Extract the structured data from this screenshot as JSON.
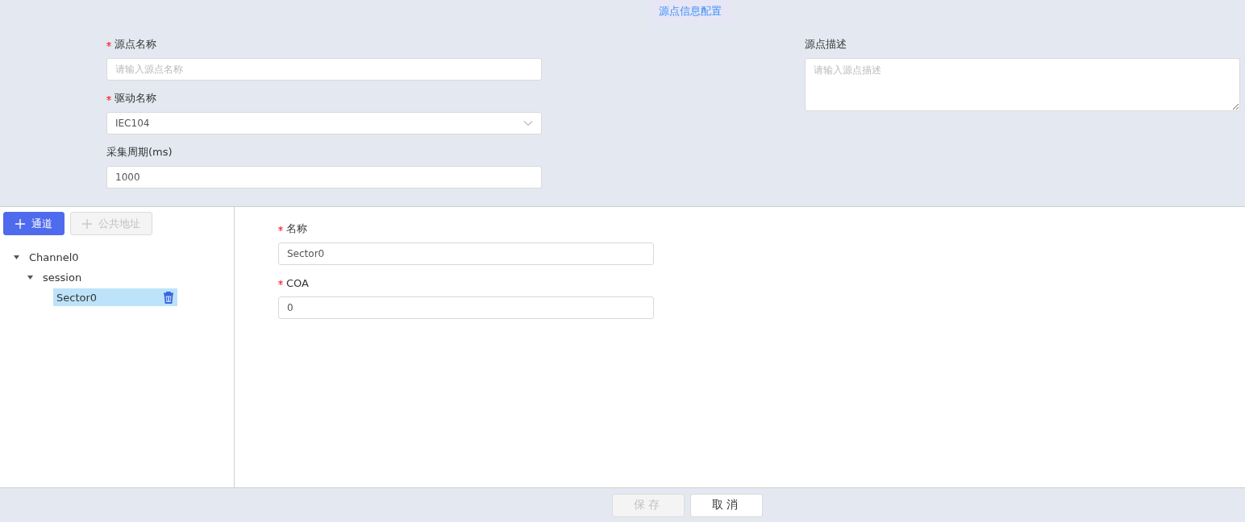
{
  "header": {
    "title": "源点信息配置"
  },
  "source_form": {
    "fields": [
      {
        "label": "源点名称",
        "required": true,
        "kind": "input",
        "placeholder": "请输入源点名称"
      },
      {
        "label": "驱动名称",
        "required": true,
        "kind": "select",
        "value": "IEC104"
      },
      {
        "label": "采集周期(ms)",
        "required": false,
        "kind": "input",
        "value": "1000"
      }
    ],
    "description": {
      "label": "源点描述",
      "required": false,
      "kind": "textarea",
      "placeholder": "请输入源点描述"
    }
  },
  "tree_toolbar": [
    {
      "label": "通道",
      "disabled": false
    },
    {
      "label": "公共地址",
      "disabled": true
    }
  ],
  "tree": [
    {
      "label": "Channel0",
      "expanded": true,
      "selected": false,
      "children": [
        {
          "label": "session",
          "expanded": true,
          "selected": false,
          "children": [
            {
              "label": "Sector0",
              "selected": true
            }
          ]
        }
      ]
    }
  ],
  "detail_form": {
    "fields": [
      {
        "label": "名称",
        "required": true,
        "kind": "input",
        "value": "Sector0"
      },
      {
        "label": "COA",
        "required": true,
        "kind": "input",
        "value": "0"
      }
    ]
  },
  "footer_buttons": [
    {
      "label": "保存",
      "disabled": true
    },
    {
      "label": "取消",
      "disabled": false
    }
  ]
}
